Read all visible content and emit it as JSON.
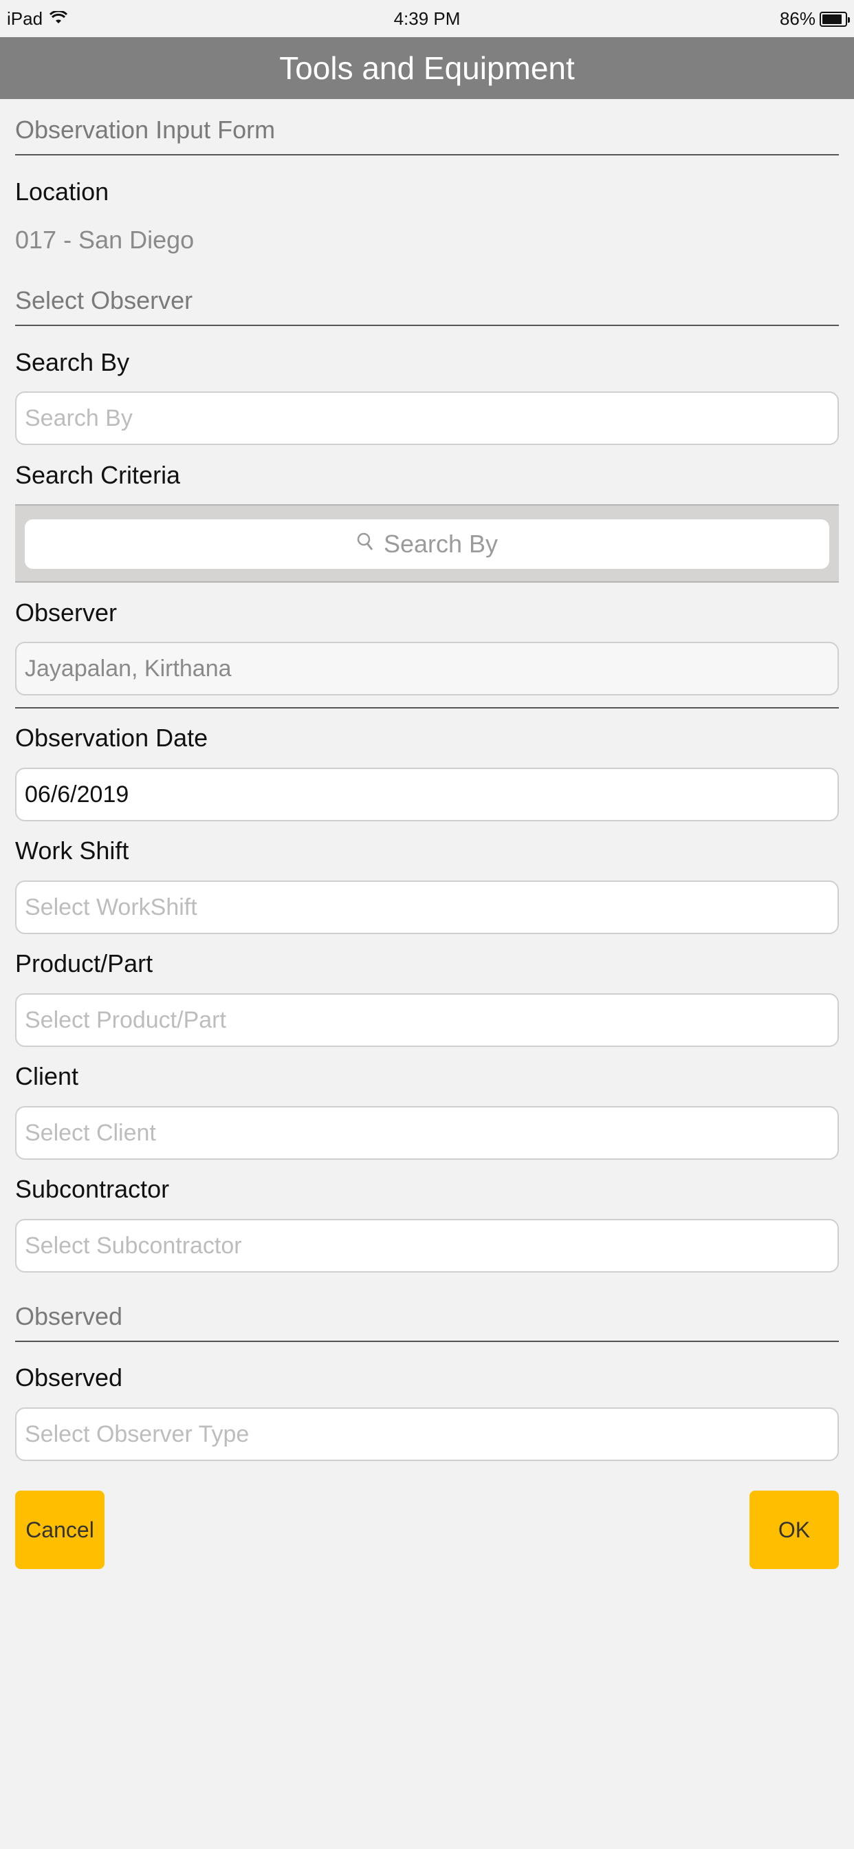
{
  "status_bar": {
    "device": "iPad",
    "time": "4:39 PM",
    "battery": "86%",
    "battery_level": 0.86
  },
  "nav": {
    "title": "Tools and Equipment"
  },
  "form": {
    "section_input": "Observation Input Form",
    "location_label": "Location",
    "location_value": "017 - San Diego",
    "section_observer": "Select Observer",
    "search_by_label": "Search By",
    "search_by_placeholder": "Search By",
    "search_criteria_label": "Search Criteria",
    "search_bar_placeholder": "Search By",
    "observer_label": "Observer",
    "observer_value": "Jayapalan, Kirthana",
    "date_label": "Observation Date",
    "date_value": "06/6/2019",
    "work_shift_label": "Work Shift",
    "work_shift_placeholder": "Select WorkShift",
    "product_label": "Product/Part",
    "product_placeholder": "Select Product/Part",
    "client_label": "Client",
    "client_placeholder": "Select Client",
    "subcontractor_label": "Subcontractor",
    "subcontractor_placeholder": "Select Subcontractor",
    "section_observed": "Observed",
    "observed_label": "Observed",
    "observed_placeholder": "Select Observer Type"
  },
  "buttons": {
    "cancel": "Cancel",
    "ok": "OK"
  },
  "colors": {
    "nav_bg": "#808080",
    "button_bg": "#ffbf00",
    "page_bg": "#f2f2f2"
  }
}
